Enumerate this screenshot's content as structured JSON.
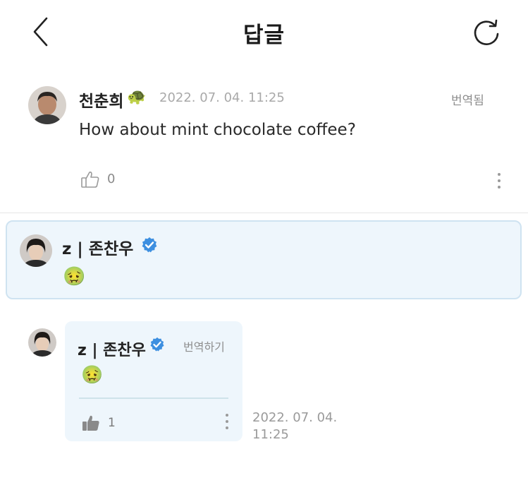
{
  "header": {
    "title": "답글",
    "icons": {
      "back": "chevron-left-icon",
      "refresh": "refresh-icon"
    }
  },
  "comment": {
    "author": "천춘희",
    "author_emoji": "🐢",
    "timestamp": "2022. 07. 04. 11:25",
    "translated_label": "번역됨",
    "text": "How about mint chocolate coffee?",
    "like_count": "0"
  },
  "highlighted_reply": {
    "author": "z | 존찬우",
    "verified": true,
    "text": "🤢"
  },
  "nested_reply": {
    "author": "z | 존찬우",
    "verified": true,
    "translate_label": "번역하기",
    "text": "🤢",
    "like_count": "1",
    "timestamp_date": "2022. 07. 04.",
    "timestamp_time": "11:25"
  },
  "colors": {
    "highlight_bg": "#eef6fc",
    "highlight_border": "#cfe3f1",
    "verified_blue": "#3d8fe0",
    "muted_text": "#a9a9a9"
  }
}
